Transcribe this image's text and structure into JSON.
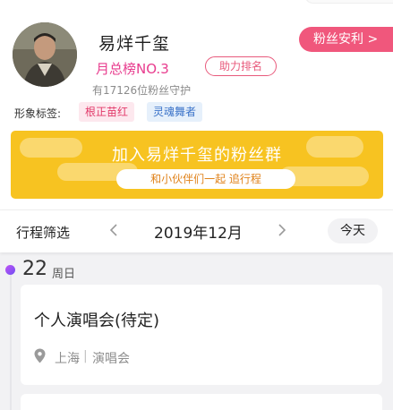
{
  "profile": {
    "name": "易烊千玺",
    "rank": "月总榜NO.3",
    "boost_label": "助力排名",
    "guard_text": "有17126位粉丝守护",
    "benefit_label": "粉丝安利 >",
    "tags_label": "形象标签:",
    "tags": [
      "根正苗红",
      "灵魂舞者"
    ]
  },
  "banner": {
    "title": "加入易烊千玺的粉丝群",
    "subtitle": "和小伙伴们一起 追行程"
  },
  "filter": {
    "label": "行程筛选",
    "month": "2019年12月",
    "today_label": "今天"
  },
  "schedule": {
    "day": "22",
    "weekday": "周日",
    "events": [
      {
        "title": "个人演唱会(待定)",
        "city": "上海",
        "separator": "|",
        "type": "演唱会"
      }
    ]
  },
  "colors": {
    "accent_pink": "#e83c8e",
    "benefit_bg": "#f0577c",
    "banner_bg": "#f7c321",
    "timeline_dot": "#9b51f3"
  },
  "icons": {
    "prev": "chevron-left-icon",
    "next": "chevron-right-icon",
    "location": "location-pin-icon"
  }
}
